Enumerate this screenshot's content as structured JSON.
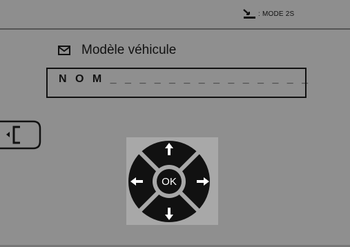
{
  "header": {
    "mode_label": ": MODE 2S",
    "mode_icon": "mode-symbol-icon"
  },
  "main": {
    "title_icon": "envelope-icon",
    "title": "Modèle véhicule",
    "name_field_value": "N O M _ _ _ _ _ _ _ _ _ _ _ _ _ _"
  },
  "nav": {
    "back_icon": "back-bracket-icon",
    "ok_label": "OK",
    "up_icon": "arrow-up-icon",
    "down_icon": "arrow-down-icon",
    "left_icon": "arrow-left-icon",
    "right_icon": "arrow-right-icon"
  },
  "colors": {
    "background": "#8f8f8f",
    "dpad_panel": "#a8a8a8",
    "dpad_ring": "#111111",
    "text": "#111111"
  }
}
